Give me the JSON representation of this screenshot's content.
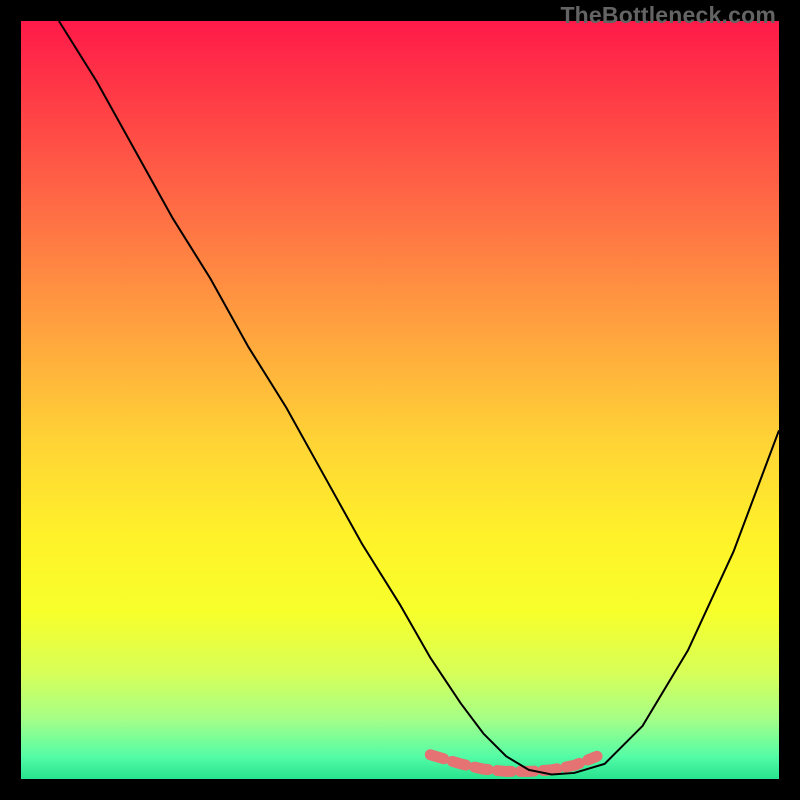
{
  "watermark": "TheBottleneck.com",
  "chart_data": {
    "type": "line",
    "title": "",
    "xlabel": "",
    "ylabel": "",
    "xlim": [
      0,
      100
    ],
    "ylim": [
      0,
      100
    ],
    "grid": false,
    "gradient_stops": [
      {
        "offset": 0.0,
        "color": "#ff1a49"
      },
      {
        "offset": 0.1,
        "color": "#ff3b46"
      },
      {
        "offset": 0.25,
        "color": "#ff6d45"
      },
      {
        "offset": 0.4,
        "color": "#ffa03f"
      },
      {
        "offset": 0.55,
        "color": "#ffd236"
      },
      {
        "offset": 0.68,
        "color": "#fff22a"
      },
      {
        "offset": 0.78,
        "color": "#f7ff2b"
      },
      {
        "offset": 0.86,
        "color": "#d7ff58"
      },
      {
        "offset": 0.92,
        "color": "#a6ff87"
      },
      {
        "offset": 0.97,
        "color": "#55fca6"
      },
      {
        "offset": 1.0,
        "color": "#27e38f"
      }
    ],
    "series": [
      {
        "name": "bottleneck-curve",
        "stroke": "#000000",
        "stroke_width": 2,
        "x": [
          5,
          10,
          15,
          20,
          25,
          30,
          35,
          40,
          45,
          50,
          54,
          58,
          61,
          64,
          67,
          70,
          73,
          77,
          82,
          88,
          94,
          100
        ],
        "y": [
          100,
          92,
          83,
          74,
          66,
          57,
          49,
          40,
          31,
          23,
          16,
          10,
          6,
          3,
          1.2,
          0.6,
          0.8,
          2,
          7,
          17,
          30,
          46
        ]
      },
      {
        "name": "highlight-band",
        "stroke": "#e57373",
        "stroke_width": 11,
        "dash": [
          14,
          9
        ],
        "x": [
          54,
          58,
          61,
          64,
          67,
          70,
          73,
          76
        ],
        "y": [
          3.2,
          2.0,
          1.3,
          1.0,
          1.0,
          1.2,
          1.8,
          3.0
        ]
      }
    ]
  }
}
